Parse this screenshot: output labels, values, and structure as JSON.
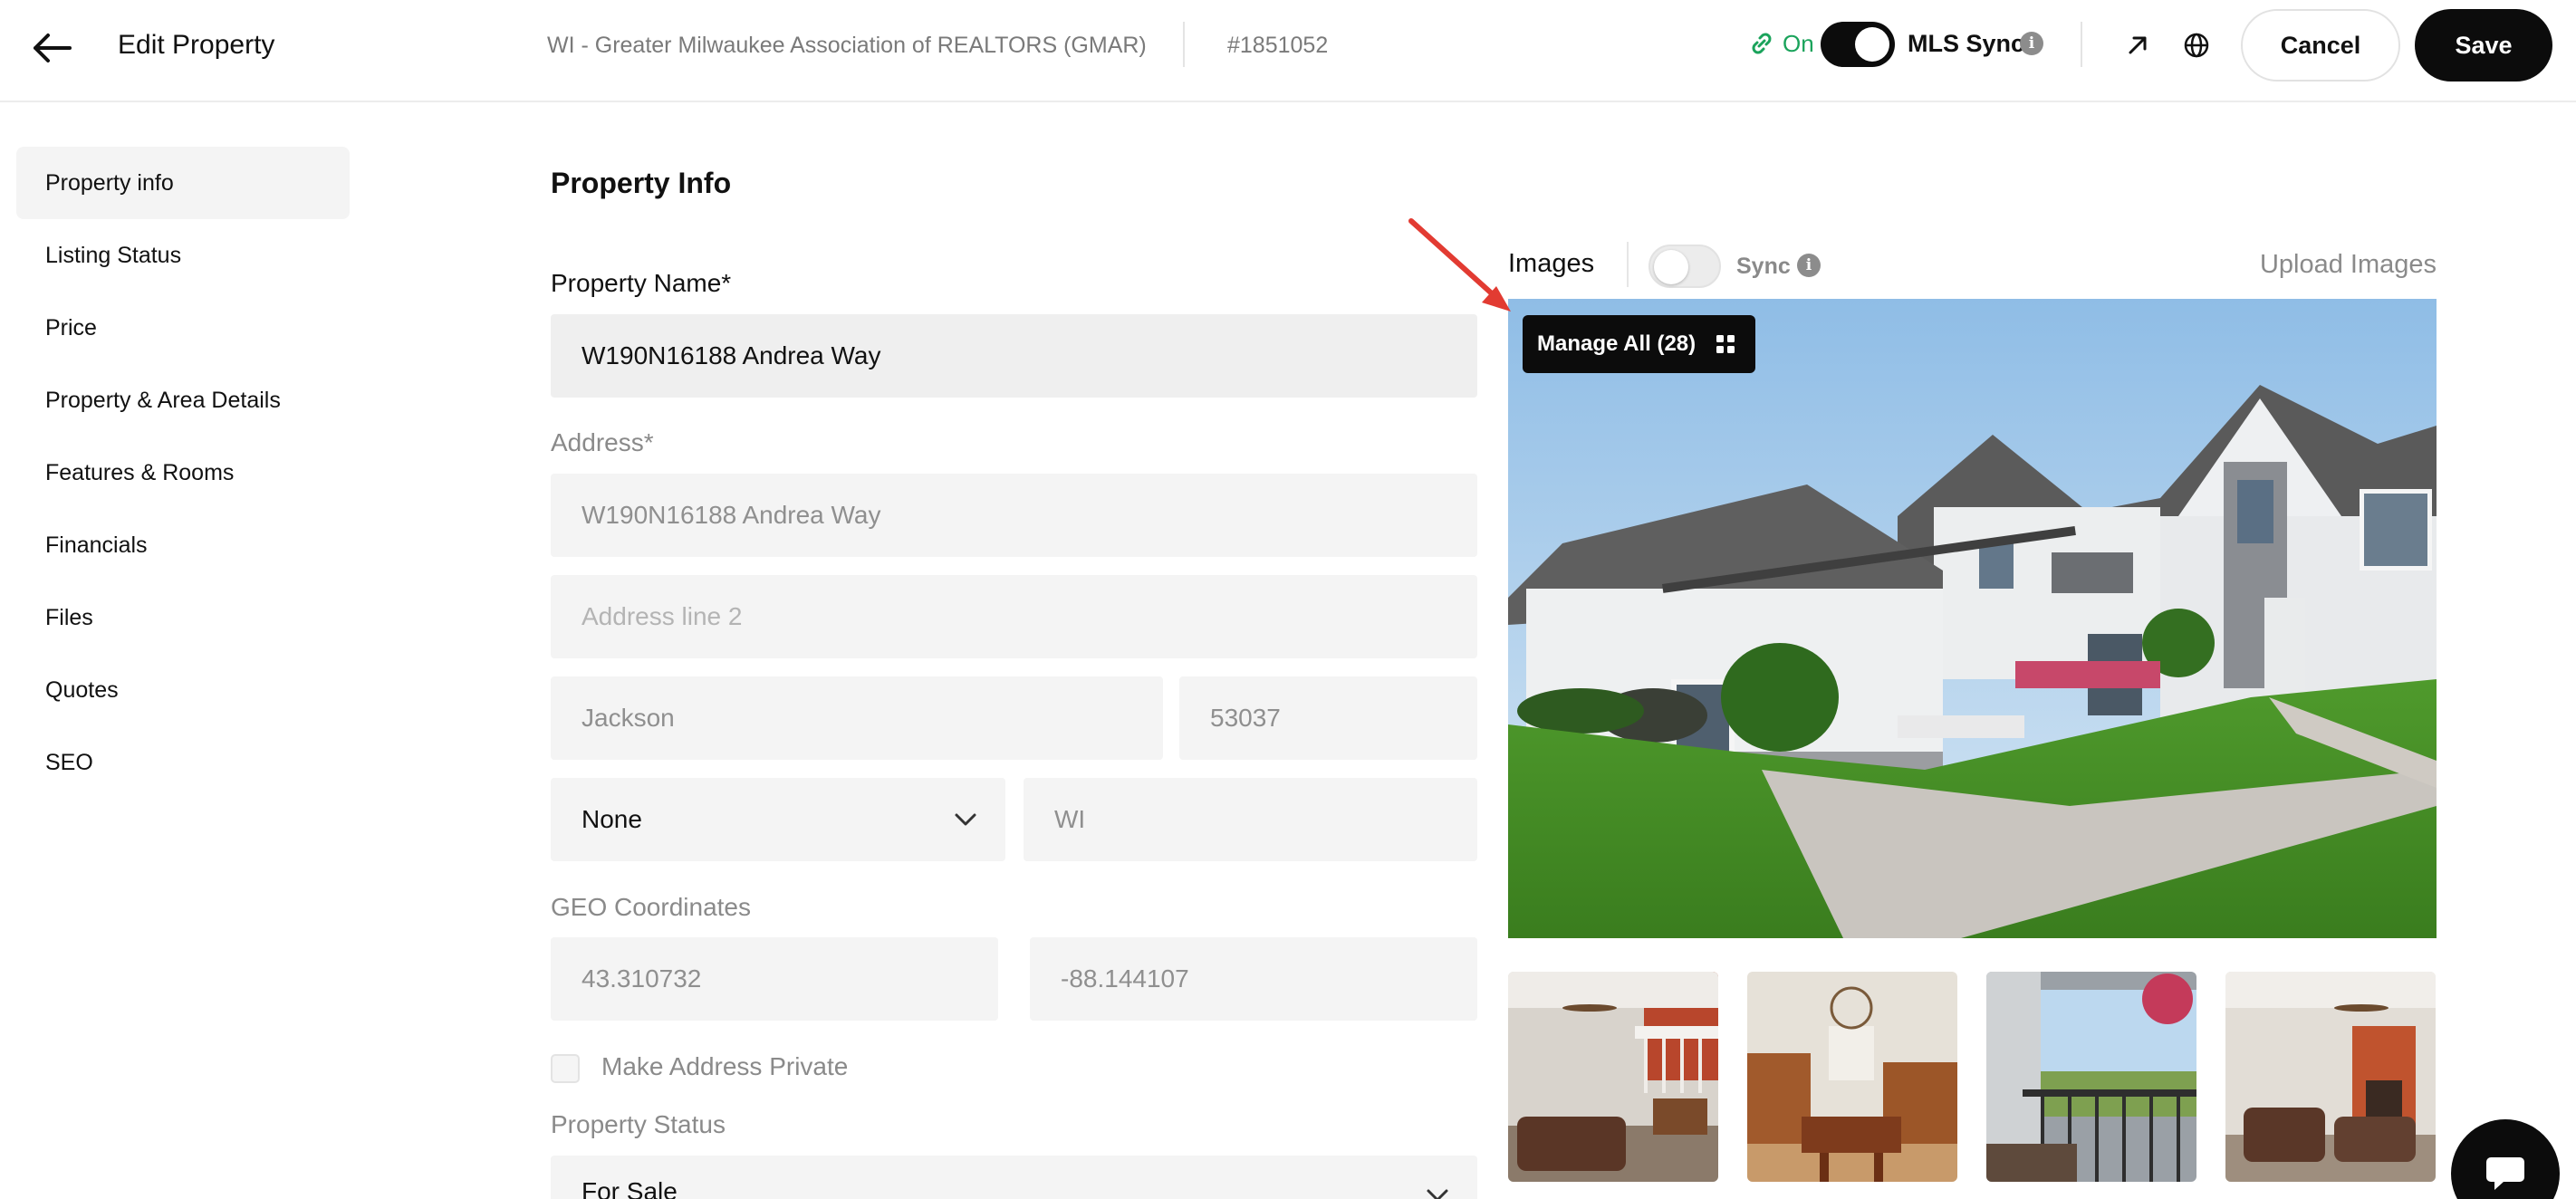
{
  "header": {
    "title": "Edit Property",
    "association": "WI - Greater Milwaukee Association of REALTORS (GMAR)",
    "mls_number": "#1851052",
    "sync_status": "On",
    "mls_sync_label": "MLS Sync",
    "cancel_label": "Cancel",
    "save_label": "Save",
    "icons": {
      "back": "arrow-left-icon",
      "link": "link-icon",
      "info": "info-icon",
      "external": "arrow-up-right-icon",
      "globe": "globe-icon"
    },
    "accent_on_color": "#1aa35b"
  },
  "sidebar": {
    "items": [
      {
        "label": "Property info",
        "active": true
      },
      {
        "label": "Listing Status"
      },
      {
        "label": "Price"
      },
      {
        "label": "Property & Area Details"
      },
      {
        "label": "Features & Rooms"
      },
      {
        "label": "Financials"
      },
      {
        "label": "Files"
      },
      {
        "label": "Quotes"
      },
      {
        "label": "SEO"
      }
    ]
  },
  "form": {
    "section_title": "Property Info",
    "property_name_label": "Property Name*",
    "property_name_value": "W190N16188 Andrea Way",
    "address_label": "Address*",
    "address_line1": "W190N16188 Andrea Way",
    "address_line2_placeholder": "Address line 2",
    "city": "Jackson",
    "zip": "53037",
    "county_select": "None",
    "state": "WI",
    "geo_label": "GEO Coordinates",
    "latitude": "43.310732",
    "longitude": "-88.144107",
    "private_label": "Make Address Private",
    "status_label": "Property Status",
    "status_value": "For Sale"
  },
  "images": {
    "label": "Images",
    "sync_label": "Sync",
    "upload_label": "Upload Images",
    "manage_label": "Manage All (28)",
    "icons": {
      "grid": "grid-icon",
      "chat": "chat-icon"
    }
  }
}
